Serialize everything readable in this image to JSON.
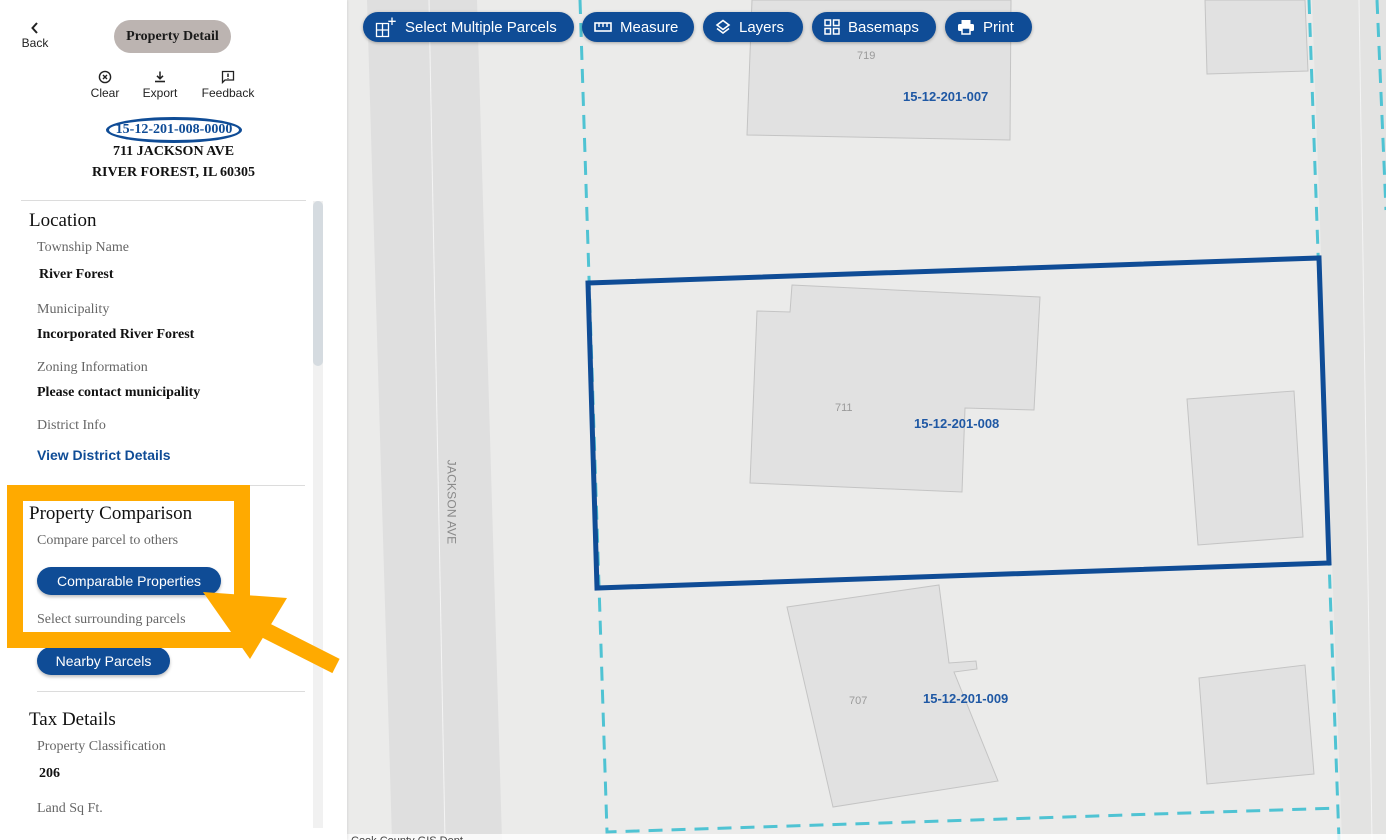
{
  "panel": {
    "back_label": "Back",
    "title": "Property Detail",
    "actions": {
      "clear": {
        "label": "Clear",
        "icon": "close-circle-icon"
      },
      "export": {
        "label": "Export",
        "icon": "download-icon"
      },
      "feedback": {
        "label": "Feedback",
        "icon": "feedback-icon"
      }
    },
    "pin": "15-12-201-008-0000",
    "address_line1": "711 JACKSON AVE",
    "address_line2": "RIVER FOREST, IL 60305",
    "location": {
      "title": "Location",
      "fields": [
        {
          "label": "Township Name",
          "value": "River Forest"
        },
        {
          "label": "Municipality",
          "value": "Incorporated River Forest"
        },
        {
          "label": "Zoning Information",
          "value": "Please contact municipality"
        },
        {
          "label": "District Info",
          "value": "View District Details"
        }
      ]
    },
    "comparison": {
      "title": "Property Comparison",
      "compare_label": "Compare parcel to others",
      "comparable_button": "Comparable Properties",
      "surrounding_label": "Select surrounding parcels",
      "nearby_button": "Nearby Parcels"
    },
    "tax": {
      "title": "Tax Details",
      "fields": [
        {
          "label": "Property Classification",
          "value": "206"
        },
        {
          "label": "Land Sq Ft.",
          "value": ""
        }
      ]
    }
  },
  "map": {
    "toolbar": [
      {
        "label": "Select Multiple Parcels",
        "icon": "grid-plus-icon"
      },
      {
        "label": "Measure",
        "icon": "ruler-icon"
      },
      {
        "label": "Layers",
        "icon": "layers-icon"
      },
      {
        "label": "Basemaps",
        "icon": "basemaps-grid-icon"
      },
      {
        "label": "Print",
        "icon": "printer-icon"
      }
    ],
    "street_name": "JACKSON AVE",
    "parcels": [
      {
        "pin": "15-12-201-007",
        "address": "719"
      },
      {
        "pin": "15-12-201-008",
        "address": "711",
        "selected": true
      },
      {
        "pin": "15-12-201-009",
        "address": "707"
      }
    ],
    "attribution": "Cook County GIS Dept.",
    "colors": {
      "selected_outline": "#0f4c96",
      "parcel_line": "#4fc3d3",
      "building_fill": "#e0e0e0",
      "background": "#ebebea",
      "annotation": "#ffaa00"
    }
  }
}
